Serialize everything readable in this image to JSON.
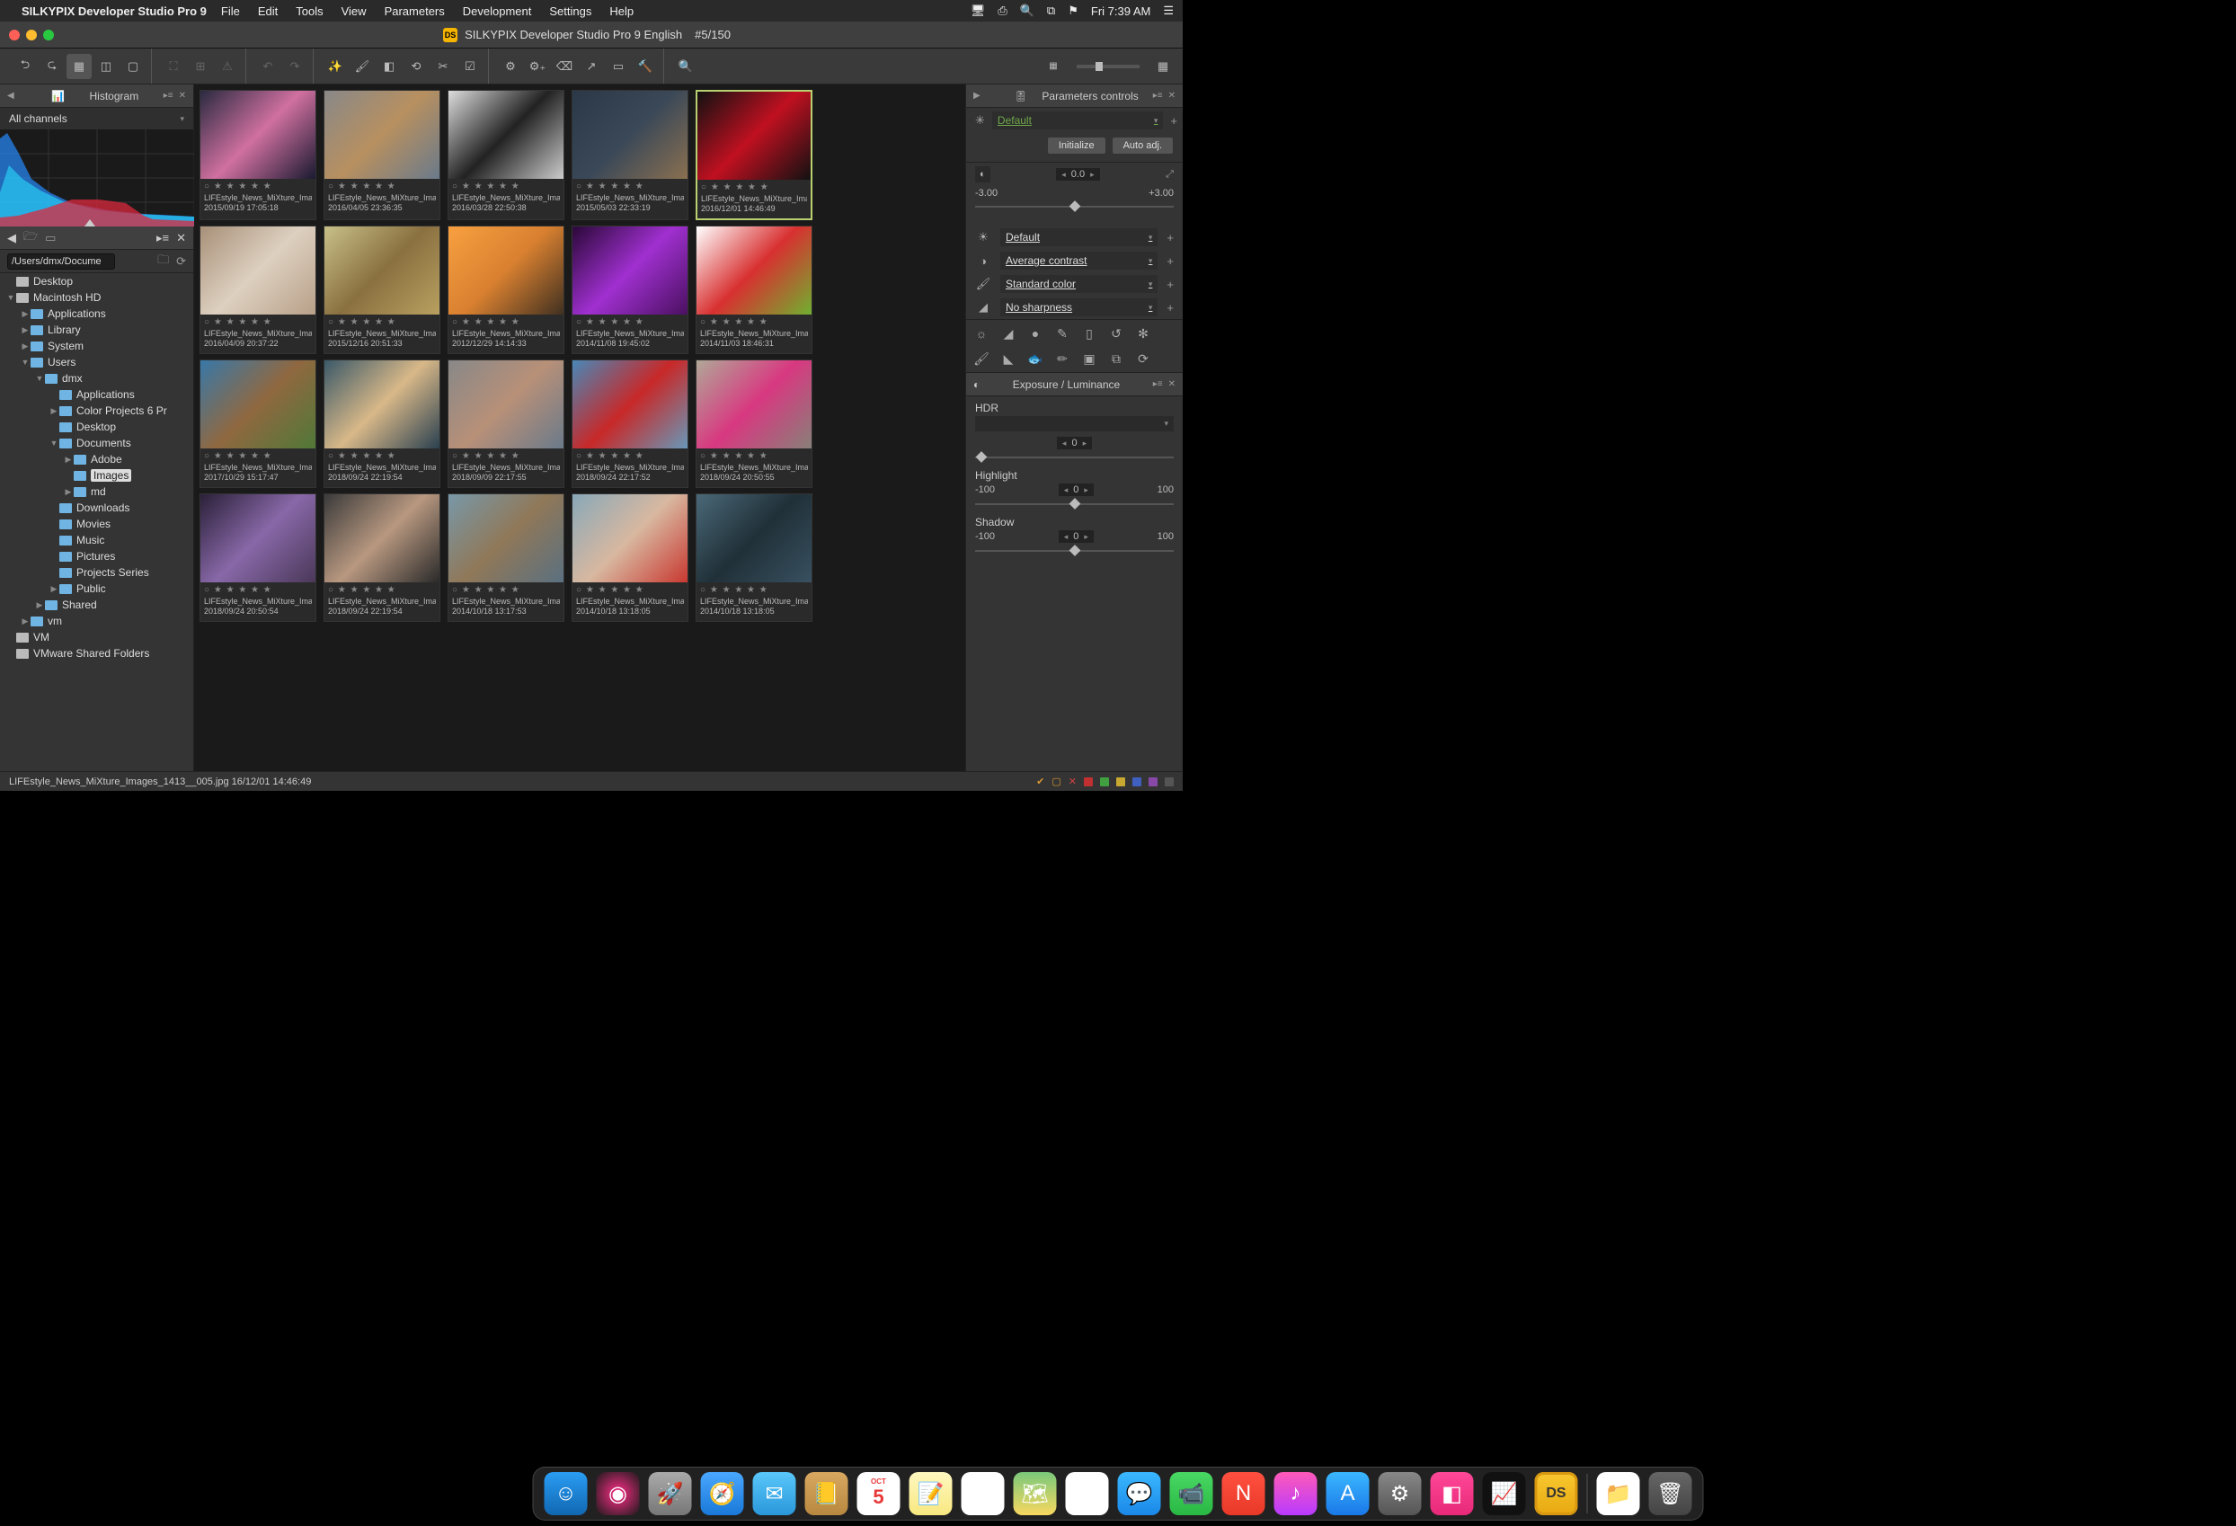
{
  "menubar": {
    "app_name": "SILKYPIX Developer Studio Pro 9",
    "items": [
      "File",
      "Edit",
      "Tools",
      "View",
      "Parameters",
      "Development",
      "Settings",
      "Help"
    ],
    "clock": "Fri 7:39 AM"
  },
  "title_bar": {
    "title": "SILKYPIX Developer Studio Pro 9 English",
    "counter": "#5/150"
  },
  "histogram": {
    "panel_title": "Histogram",
    "channel": "All channels"
  },
  "path_input": "/Users/dmx/Docume",
  "folder_tree": [
    {
      "indent": 0,
      "arrow": "",
      "icon": "drive",
      "label": "Desktop"
    },
    {
      "indent": 0,
      "arrow": "▼",
      "icon": "drive",
      "label": "Macintosh HD"
    },
    {
      "indent": 1,
      "arrow": "▶",
      "icon": "folder",
      "label": "Applications"
    },
    {
      "indent": 1,
      "arrow": "▶",
      "icon": "folder",
      "label": "Library"
    },
    {
      "indent": 1,
      "arrow": "▶",
      "icon": "folder",
      "label": "System"
    },
    {
      "indent": 1,
      "arrow": "▼",
      "icon": "folder",
      "label": "Users"
    },
    {
      "indent": 2,
      "arrow": "▼",
      "icon": "folder",
      "label": "dmx"
    },
    {
      "indent": 3,
      "arrow": "",
      "icon": "folder",
      "label": "Applications"
    },
    {
      "indent": 3,
      "arrow": "▶",
      "icon": "folder",
      "label": "Color Projects 6 Pr"
    },
    {
      "indent": 3,
      "arrow": "",
      "icon": "folder",
      "label": "Desktop"
    },
    {
      "indent": 3,
      "arrow": "▼",
      "icon": "folder",
      "label": "Documents"
    },
    {
      "indent": 4,
      "arrow": "▶",
      "icon": "folder",
      "label": "Adobe"
    },
    {
      "indent": 4,
      "arrow": "",
      "icon": "folder",
      "label": "Images",
      "selected": true
    },
    {
      "indent": 4,
      "arrow": "▶",
      "icon": "folder",
      "label": "md"
    },
    {
      "indent": 3,
      "arrow": "",
      "icon": "folder",
      "label": "Downloads"
    },
    {
      "indent": 3,
      "arrow": "",
      "icon": "folder",
      "label": "Movies"
    },
    {
      "indent": 3,
      "arrow": "",
      "icon": "folder",
      "label": "Music"
    },
    {
      "indent": 3,
      "arrow": "",
      "icon": "folder",
      "label": "Pictures"
    },
    {
      "indent": 3,
      "arrow": "",
      "icon": "folder",
      "label": "Projects Series"
    },
    {
      "indent": 3,
      "arrow": "▶",
      "icon": "folder",
      "label": "Public"
    },
    {
      "indent": 2,
      "arrow": "▶",
      "icon": "folder",
      "label": "Shared"
    },
    {
      "indent": 1,
      "arrow": "▶",
      "icon": "folder",
      "label": "vm"
    },
    {
      "indent": 0,
      "arrow": "",
      "icon": "drive",
      "label": "VM"
    },
    {
      "indent": 0,
      "arrow": "",
      "icon": "drive",
      "label": "VMware Shared Folders"
    }
  ],
  "thumbnails": [
    {
      "name": "LIFEstyle_News_MiXture_Image",
      "date": "2015/09/19 17:05:18",
      "colors": [
        "#2a2a40",
        "#d070a0",
        "#1a1a30"
      ],
      "sel": false
    },
    {
      "name": "LIFEstyle_News_MiXture_Image",
      "date": "2016/04/05 23:36:35",
      "colors": [
        "#888",
        "#b89060",
        "#6a7a8a"
      ],
      "sel": false
    },
    {
      "name": "LIFEstyle_News_MiXture_Image",
      "date": "2016/03/28 22:50:38",
      "colors": [
        "#ddd",
        "#222",
        "#ccc"
      ],
      "sel": false
    },
    {
      "name": "LIFEstyle_News_MiXture_Image",
      "date": "2015/05/03 22:33:19",
      "colors": [
        "#2a3848",
        "#3a4858",
        "#8a7050"
      ],
      "sel": false
    },
    {
      "name": "LIFEstyle_News_MiXture_Image",
      "date": "2016/12/01 14:46:49",
      "colors": [
        "#111",
        "#c01020",
        "#111"
      ],
      "sel": true
    },
    {
      "name": "LIFEstyle_News_MiXture_Image",
      "date": "2016/04/09 20:37:22",
      "colors": [
        "#a89078",
        "#ddd0c0",
        "#b8a088"
      ],
      "sel": false
    },
    {
      "name": "LIFEstyle_News_MiXture_Image",
      "date": "2015/12/16 20:51:33",
      "colors": [
        "#c8c088",
        "#8a7040",
        "#b8a060"
      ],
      "sel": false
    },
    {
      "name": "LIFEstyle_News_MiXture_Image",
      "date": "2012/12/29 14:14:33",
      "colors": [
        "#f8a040",
        "#d88030",
        "#403020"
      ],
      "sel": false
    },
    {
      "name": "LIFEstyle_News_MiXture_Image",
      "date": "2014/11/08 19:45:02",
      "colors": [
        "#2a0838",
        "#a030d0",
        "#4a1060"
      ],
      "sel": false
    },
    {
      "name": "LIFEstyle_News_MiXture_Image",
      "date": "2014/11/03 18:46:31",
      "colors": [
        "#fff",
        "#d83030",
        "#70b030"
      ],
      "sel": false
    },
    {
      "name": "LIFEstyle_News_MiXture_Image",
      "date": "2017/10/29 15:17:47",
      "colors": [
        "#3878a8",
        "#906840",
        "#507838"
      ],
      "sel": false
    },
    {
      "name": "LIFEstyle_News_MiXture_Image",
      "date": "2018/09/24 22:19:54",
      "colors": [
        "#3a5868",
        "#d8b888",
        "#2a4050"
      ],
      "sel": false
    },
    {
      "name": "LIFEstyle_News_MiXture_Image",
      "date": "2018/09/09 22:17:55",
      "colors": [
        "#888",
        "#b89078",
        "#6a7a8a"
      ],
      "sel": false
    },
    {
      "name": "LIFEstyle_News_MiXture_Image",
      "date": "2018/09/24 22:17:52",
      "colors": [
        "#4888b8",
        "#c82828",
        "#6898b8"
      ],
      "sel": false
    },
    {
      "name": "LIFEstyle_News_MiXture_Image",
      "date": "2018/09/24 20:50:55",
      "colors": [
        "#b0a898",
        "#d83880",
        "#888078"
      ],
      "sel": false
    },
    {
      "name": "LIFEstyle_News_MiXture_Image",
      "date": "2018/09/24 20:50:54",
      "colors": [
        "#2a2038",
        "#8868a8",
        "#4a3858"
      ],
      "sel": false
    },
    {
      "name": "LIFEstyle_News_MiXture_Image",
      "date": "2018/09/24 22:19:54",
      "colors": [
        "#3a3a3a",
        "#b89880",
        "#2a2a2a"
      ],
      "sel": false
    },
    {
      "name": "LIFEstyle_News_MiXture_Image",
      "date": "2014/10/18 13:17:53",
      "colors": [
        "#7898a8",
        "#907858",
        "#5a7080"
      ],
      "sel": false
    },
    {
      "name": "LIFEstyle_News_MiXture_Image",
      "date": "2014/10/18 13:18:05",
      "colors": [
        "#88a8b8",
        "#d8b8a0",
        "#c83830"
      ],
      "sel": false
    },
    {
      "name": "LIFEstyle_News_MiXture_Image",
      "date": "2014/10/18 13:18:05",
      "colors": [
        "#4a6878",
        "#203038",
        "#385060"
      ],
      "sel": false
    }
  ],
  "parameters": {
    "panel_title": "Parameters controls",
    "preset": "Default",
    "btn_init": "Initialize",
    "btn_auto": "Auto adj.",
    "exposure_value": "0.0",
    "exposure_min": "-3.00",
    "exposure_max": "+3.00",
    "wb": "Default",
    "contrast": "Average contrast",
    "color": "Standard color",
    "sharpness": "No sharpness"
  },
  "exposure_panel": {
    "title": "Exposure / Luminance",
    "hdr_label": "HDR",
    "hdr_value": "0",
    "highlight_label": "Highlight",
    "highlight_min": "-100",
    "highlight_val": "0",
    "highlight_max": "100",
    "shadow_label": "Shadow",
    "shadow_min": "-100",
    "shadow_val": "0",
    "shadow_max": "100"
  },
  "status": {
    "filename": "LIFEstyle_News_MiXture_Images_1413__005.jpg 16/12/01 14:46:49"
  },
  "dock_apps": [
    {
      "name": "finder",
      "bg": "linear-gradient(#2a9df4,#1167b1)",
      "glyph": "☺"
    },
    {
      "name": "siri",
      "bg": "radial-gradient(circle,#ff2d88,#1a1a1a)",
      "glyph": "◉"
    },
    {
      "name": "launchpad",
      "bg": "linear-gradient(#aaa,#777)",
      "glyph": "🚀"
    },
    {
      "name": "safari",
      "bg": "linear-gradient(#4aa8ff,#1a78d8)",
      "glyph": "🧭"
    },
    {
      "name": "mail",
      "bg": "linear-gradient(#5ac8fa,#2a98da)",
      "glyph": "✉"
    },
    {
      "name": "contacts",
      "bg": "linear-gradient(#d8a860,#b88840)",
      "glyph": "📒"
    },
    {
      "name": "calendar",
      "bg": "#fff",
      "glyph": "5"
    },
    {
      "name": "notes",
      "bg": "linear-gradient(#fff8c0,#f8e880)",
      "glyph": "📝"
    },
    {
      "name": "reminders",
      "bg": "#fff",
      "glyph": "⋮"
    },
    {
      "name": "maps",
      "bg": "linear-gradient(#7ac87a,#f8d860)",
      "glyph": "🗺"
    },
    {
      "name": "photos",
      "bg": "#fff",
      "glyph": "✿"
    },
    {
      "name": "messages",
      "bg": "linear-gradient(#3ab8ff,#1a88e8)",
      "glyph": "💬"
    },
    {
      "name": "facetime",
      "bg": "linear-gradient(#4ad864,#2ab844)",
      "glyph": "📹"
    },
    {
      "name": "news",
      "bg": "linear-gradient(#ff5040,#e83828)",
      "glyph": "N"
    },
    {
      "name": "itunes",
      "bg": "linear-gradient(#ff5ab8,#b83aff)",
      "glyph": "♪"
    },
    {
      "name": "appstore",
      "bg": "linear-gradient(#3ab8ff,#1a78e8)",
      "glyph": "A"
    },
    {
      "name": "preferences",
      "bg": "linear-gradient(#888,#555)",
      "glyph": "⚙"
    },
    {
      "name": "cleaner",
      "bg": "linear-gradient(#ff4898,#e82878)",
      "glyph": "◧"
    },
    {
      "name": "activity",
      "bg": "#111",
      "glyph": "📈"
    },
    {
      "name": "silkypix",
      "bg": "linear-gradient(#f8c830,#e8a810)",
      "glyph": "DS"
    },
    {
      "name": "sep",
      "bg": "",
      "glyph": ""
    },
    {
      "name": "downloads",
      "bg": "#fff",
      "glyph": "📁"
    },
    {
      "name": "trash",
      "bg": "linear-gradient(#666,#444)",
      "glyph": "🗑"
    }
  ]
}
